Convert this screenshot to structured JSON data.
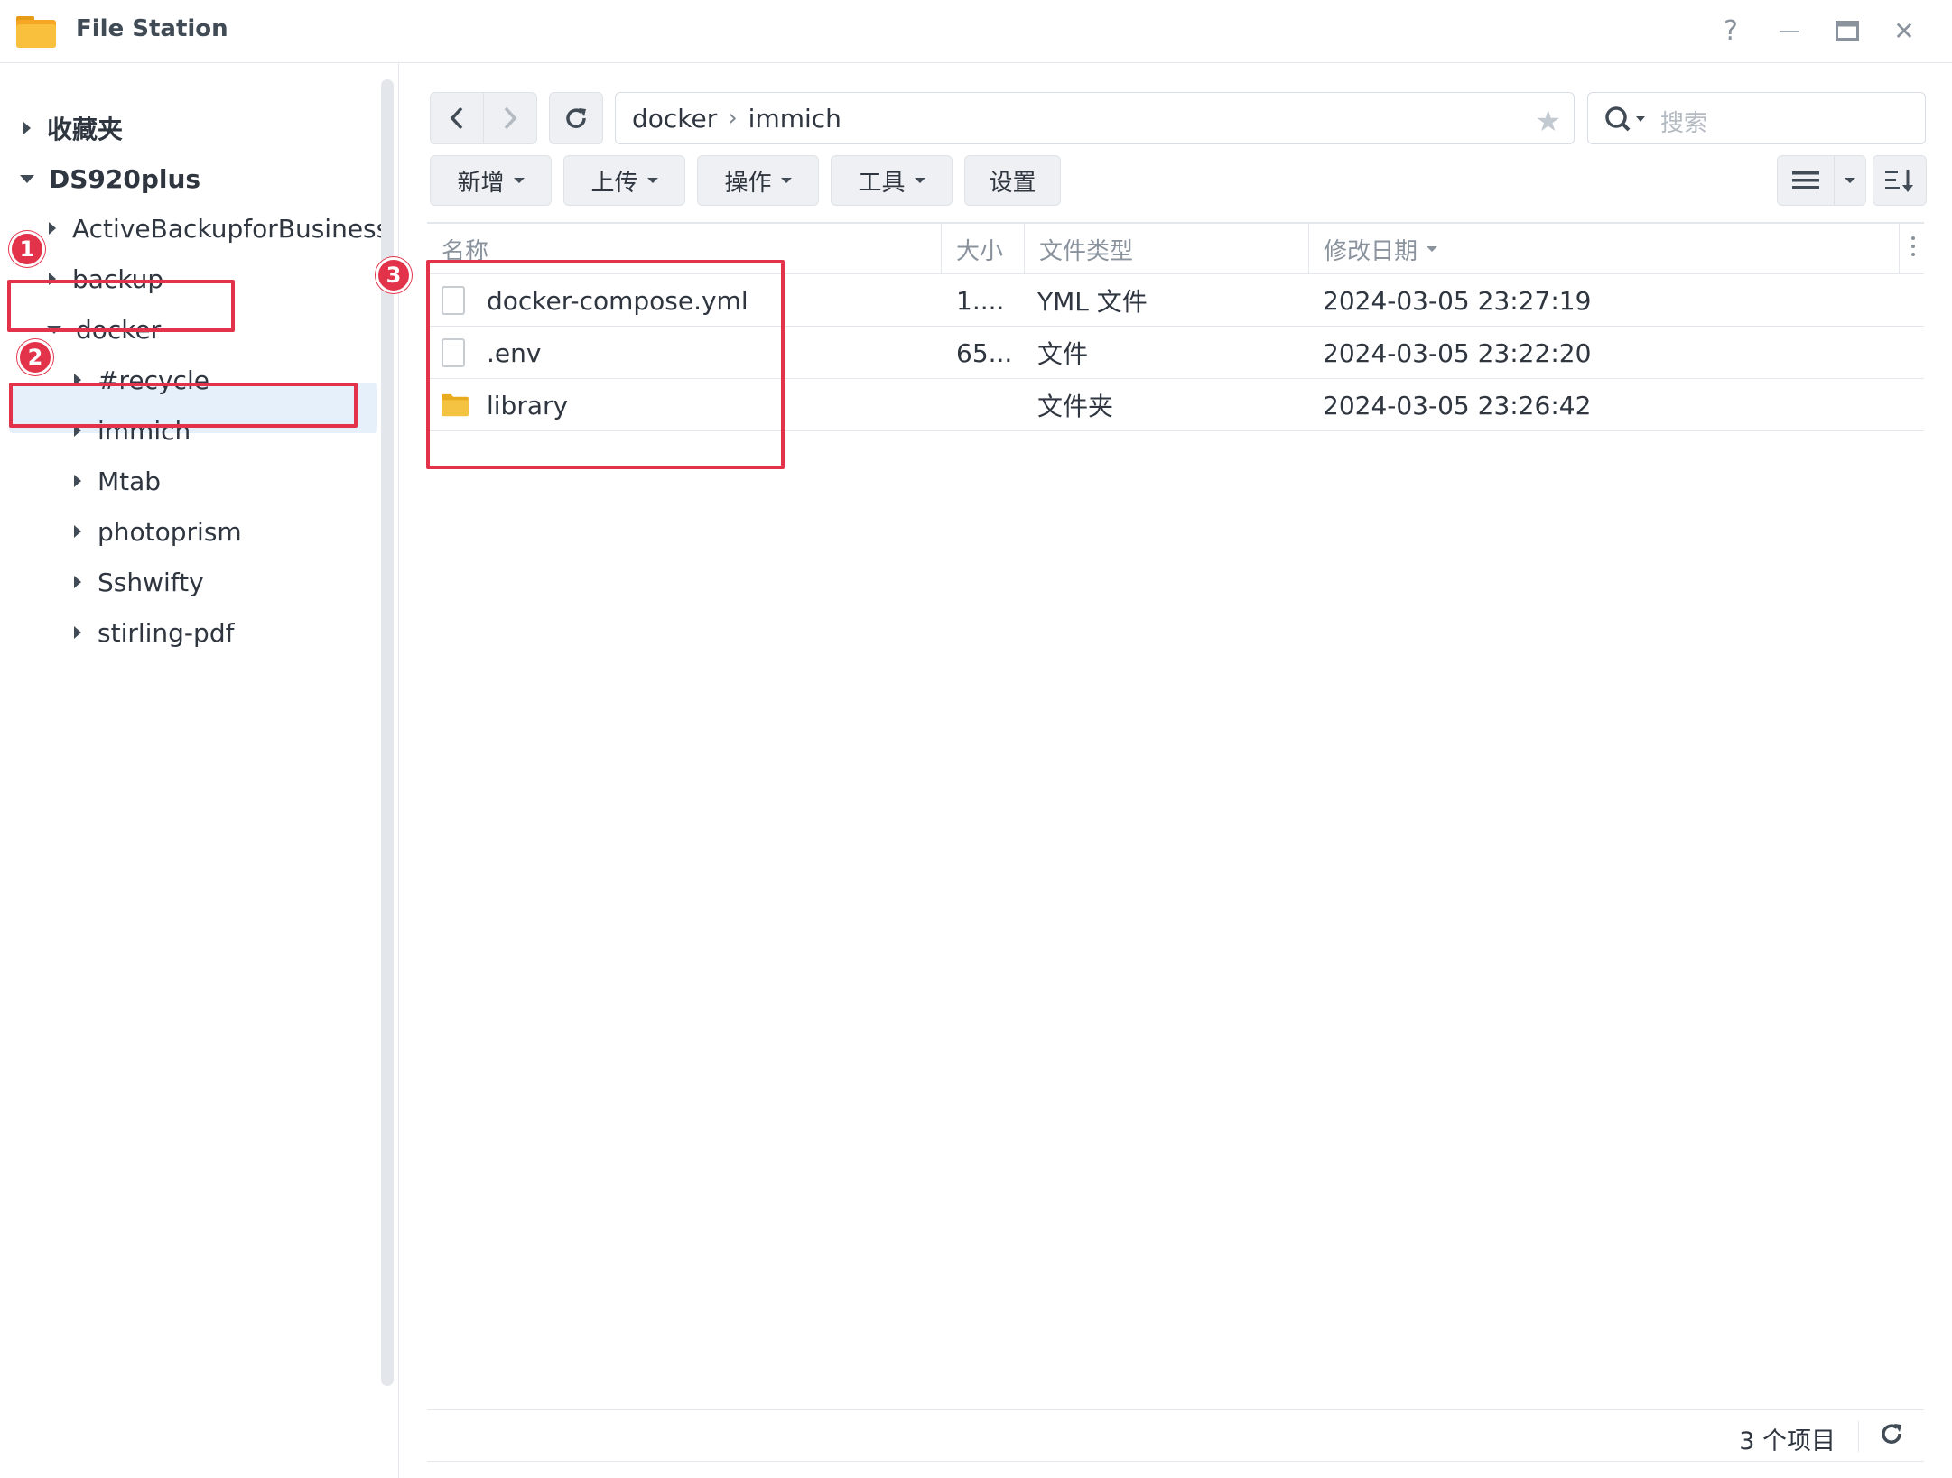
{
  "window": {
    "title": "File Station",
    "help": "?",
    "minimize": "—",
    "close": "✕"
  },
  "sidebar": {
    "favorites": "收藏夹",
    "root": "DS920plus",
    "items": [
      {
        "label": "ActiveBackupforBusiness"
      },
      {
        "label": "backup"
      },
      {
        "label": "docker"
      },
      {
        "label": "#recycle"
      },
      {
        "label": "immich"
      },
      {
        "label": "Mtab"
      },
      {
        "label": "photoprism"
      },
      {
        "label": "Sshwifty"
      },
      {
        "label": "stirling-pdf"
      }
    ],
    "selected": "immich"
  },
  "toolbar": {
    "path": [
      "docker",
      "immich"
    ],
    "path_separator": "›",
    "search_placeholder": "搜索",
    "buttons": [
      "新增",
      "上传",
      "操作",
      "工具",
      "设置"
    ]
  },
  "table": {
    "columns": [
      "名称",
      "大小",
      "文件类型",
      "修改日期"
    ],
    "rows": [
      {
        "icon": "file-icon",
        "name": "docker-compose.yml",
        "size": "1....",
        "type": "YML 文件",
        "date": "2024-03-05 23:27:19"
      },
      {
        "icon": "file-icon",
        "name": ".env",
        "size": "65...",
        "type": "文件",
        "date": "2024-03-05 23:22:20"
      },
      {
        "icon": "folder-icon",
        "name": "library",
        "size": "",
        "type": "文件夹",
        "date": "2024-03-05 23:26:42"
      }
    ]
  },
  "status": {
    "count": "3 个项目"
  },
  "annotations": [
    "1",
    "2",
    "3"
  ],
  "colors": {
    "highlight": "#e2334a",
    "selection": "#e6f0fb",
    "folder": "#f5c342"
  }
}
